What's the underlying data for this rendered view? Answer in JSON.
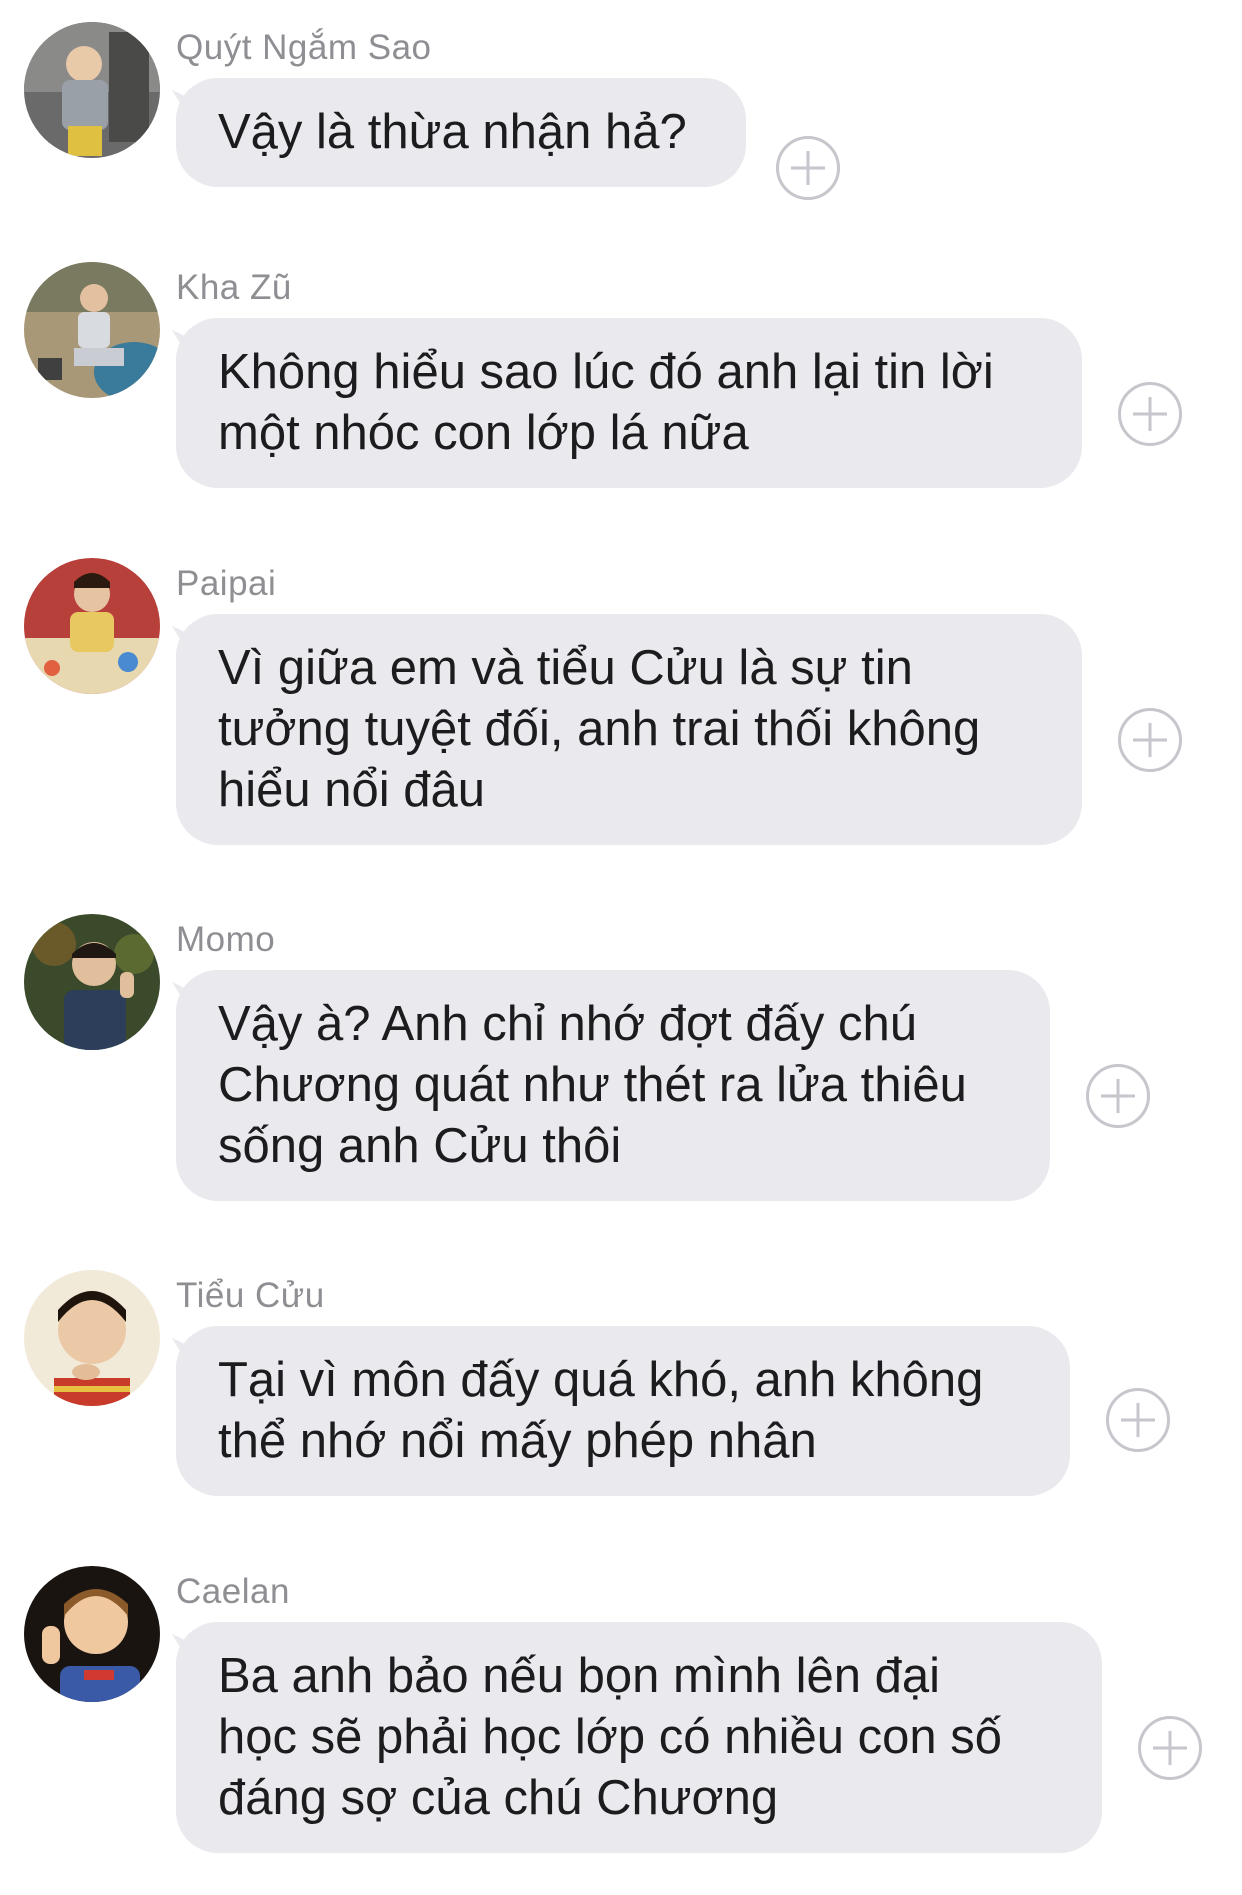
{
  "messages": [
    {
      "sender": "Quýt Ngắm Sao",
      "text": "Vậy là thừa nhận hả?",
      "avatar": "avatar-photo-boy-jacket"
    },
    {
      "sender": "Kha Zũ",
      "text": "Không hiểu sao lúc đó anh lại tin lời\nmột nhóc con lớp lá nữa",
      "avatar": "avatar-photo-boy-sitting"
    },
    {
      "sender": "Paipai",
      "text": "Vì giữa em và tiểu Cửu là sự tin\ntưởng tuyệt đối, anh trai thối không\nhiểu nổi đâu",
      "avatar": "avatar-photo-boy-apron"
    },
    {
      "sender": "Momo",
      "text": "Vậy à? Anh chỉ nhớ đợt đấy chú\nChương quát như thét ra lửa thiêu\nsống anh Cửu thôi",
      "avatar": "avatar-photo-boy-peace-sign"
    },
    {
      "sender": "Tiểu Cửu",
      "text": "Tại vì môn đấy quá khó, anh không\nthể nhớ nổi mấy phép nhân",
      "avatar": "avatar-photo-boy-chin-hand"
    },
    {
      "sender": "Caelan",
      "text": "Ba anh bảo nếu bọn mình lên đại\nhọc sẽ phải học lớp có nhiều con số\nđáng sợ của chú Chương",
      "avatar": "avatar-photo-boy-waving"
    }
  ],
  "colors": {
    "bubble": "#e9e9ee",
    "text": "#1c1c1e",
    "sender": "#8e8e93",
    "add_icon": "#c6c6cc"
  }
}
